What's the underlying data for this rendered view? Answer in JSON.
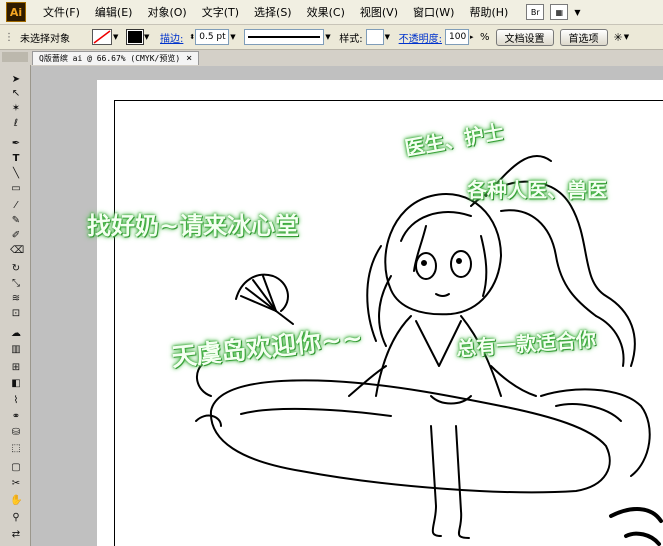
{
  "app": {
    "logo": "Ai"
  },
  "menu": [
    "文件(F)",
    "编辑(E)",
    "对象(O)",
    "文字(T)",
    "选择(S)",
    "效果(C)",
    "视图(V)",
    "窗口(W)",
    "帮助(H)"
  ],
  "control": {
    "selection_label": "未选择对象",
    "stroke_label": "描边:",
    "stroke_value": "0.5 pt",
    "style_label": "样式:",
    "opacity_label": "不透明度:",
    "opacity_value": "100",
    "opacity_unit": "%",
    "doc_setup": "文档设置",
    "preferences": "首选项"
  },
  "tab": {
    "title": "Q版蔷缤 ai @ 66.67% (CMYK/预览)",
    "close": "×"
  },
  "overlay": {
    "t1": "医生、护士",
    "t2": "各种人医、兽医",
    "t3": "找好奶~请来冰心堂",
    "t4": "天虞岛欢迎你~~",
    "t5": "总有一款适合你"
  },
  "colors": {
    "menu_bg": "#f1efe2",
    "toolbar_bg": "#ece9d8",
    "link": "#0033cc",
    "overlay_glow": "#3fb43f"
  }
}
